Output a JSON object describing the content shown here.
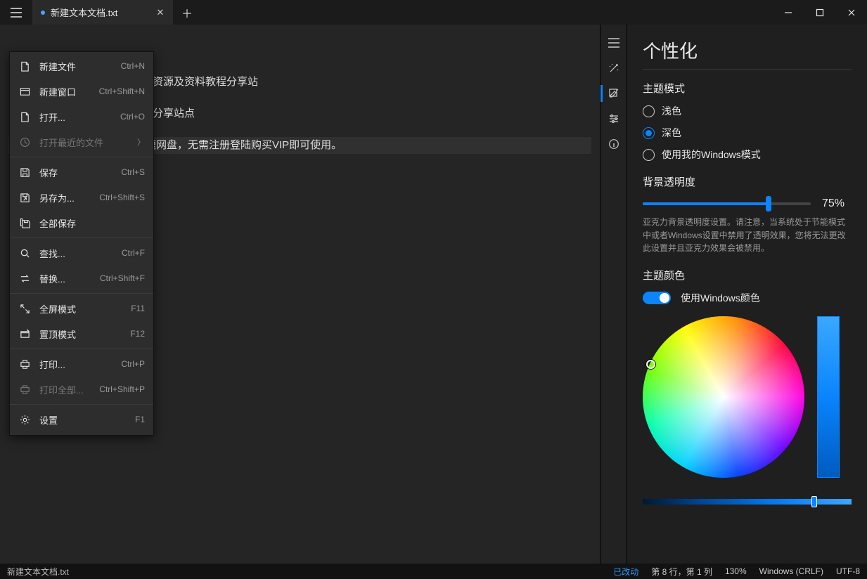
{
  "tab": {
    "title": "新建文本文档.txt",
    "modified": true
  },
  "window_controls": {
    "min": "minimize",
    "max": "maximize",
    "close": "close"
  },
  "editor": {
    "lines": [
      "资源及资料教程分享站",
      "分享站点",
      "速网盘，无需注册登陆购买VIP即可使用。"
    ]
  },
  "menu": {
    "items": [
      {
        "icon": "file-new",
        "label": "新建文件",
        "shortcut": "Ctrl+N"
      },
      {
        "icon": "window-new",
        "label": "新建窗口",
        "shortcut": "Ctrl+Shift+N"
      },
      {
        "icon": "open",
        "label": "打开...",
        "shortcut": "Ctrl+O"
      },
      {
        "icon": "recent",
        "label": "打开最近的文件",
        "submenu": true,
        "disabled": true
      },
      {
        "sep": true
      },
      {
        "icon": "save",
        "label": "保存",
        "shortcut": "Ctrl+S"
      },
      {
        "icon": "saveas",
        "label": "另存为...",
        "shortcut": "Ctrl+Shift+S"
      },
      {
        "icon": "saveall",
        "label": "全部保存"
      },
      {
        "sep": true
      },
      {
        "icon": "find",
        "label": "查找...",
        "shortcut": "Ctrl+F"
      },
      {
        "icon": "replace",
        "label": "替换...",
        "shortcut": "Ctrl+Shift+F"
      },
      {
        "sep": true
      },
      {
        "icon": "fullscreen",
        "label": "全屏模式",
        "shortcut": "F11"
      },
      {
        "icon": "ontop",
        "label": "置顶模式",
        "shortcut": "F12"
      },
      {
        "sep": true
      },
      {
        "icon": "print",
        "label": "打印...",
        "shortcut": "Ctrl+P"
      },
      {
        "icon": "printall",
        "label": "打印全部...",
        "shortcut": "Ctrl+Shift+P",
        "disabled": true
      },
      {
        "sep": true
      },
      {
        "icon": "settings",
        "label": "设置",
        "shortcut": "F1"
      }
    ]
  },
  "sidebar_icons": [
    "menu",
    "magic",
    "edit",
    "sliders",
    "info"
  ],
  "panel": {
    "title": "个性化",
    "theme": {
      "label": "主题模式",
      "options": [
        "浅色",
        "深色",
        "使用我的Windows模式"
      ],
      "selected": 1
    },
    "opacity": {
      "label": "背景透明度",
      "value_text": "75%",
      "value": 75,
      "note": "亚克力背景透明度设置。请注意，当系统处于节能模式中或者Windows设置中禁用了透明效果，您将无法更改此设置并且亚克力效果会被禁用。"
    },
    "accent": {
      "label": "主题颜色",
      "toggle_label": "使用Windows颜色",
      "toggle_on": true
    }
  },
  "status": {
    "file": "新建文本文档.txt",
    "modified": "已改动",
    "cursor": "第 8 行，第 1 列",
    "zoom": "130%",
    "eol": "Windows (CRLF)",
    "encoding": "UTF-8"
  }
}
